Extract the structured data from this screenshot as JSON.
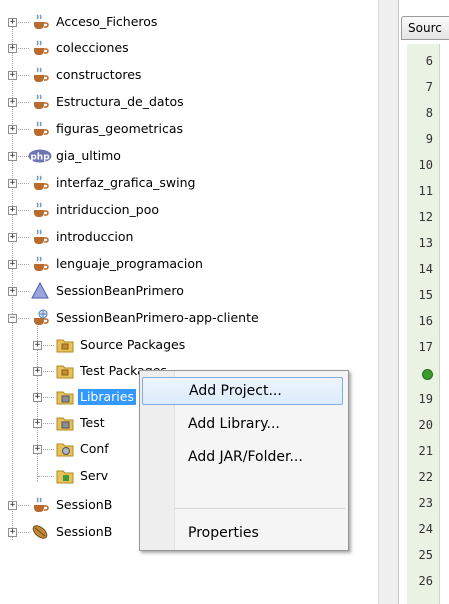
{
  "project_tree": {
    "projects": [
      {
        "label": "Acceso_Ficheros",
        "icon": "java-cup-icon"
      },
      {
        "label": "colecciones",
        "icon": "java-cup-icon"
      },
      {
        "label": "constructores",
        "icon": "java-cup-icon"
      },
      {
        "label": "Estructura_de_datos",
        "icon": "java-cup-icon"
      },
      {
        "label": "figuras_geometricas",
        "icon": "java-cup-icon"
      },
      {
        "label": "gia_ultimo",
        "icon": "php-icon"
      },
      {
        "label": "interfaz_grafica_swing",
        "icon": "java-cup-icon"
      },
      {
        "label": "intriduccion_poo",
        "icon": "java-cup-icon"
      },
      {
        "label": "introduccion",
        "icon": "java-cup-icon"
      },
      {
        "label": "lenguaje_programacion",
        "icon": "java-cup-icon"
      },
      {
        "label": "SessionBeanPrimero",
        "icon": "ejb-triangle-icon"
      },
      {
        "label": "SessionBeanPrimero-app-cliente",
        "icon": "java-app-client-icon"
      }
    ],
    "children": [
      {
        "label": "Source Packages",
        "icon": "package-folder-icon"
      },
      {
        "label": "Test Packages",
        "icon": "package-folder-icon"
      },
      {
        "label": "Libraries",
        "icon": "library-folder-icon",
        "selected": true
      },
      {
        "label": "Test",
        "icon": "library-folder-icon"
      },
      {
        "label": "Conf",
        "icon": "config-folder-icon"
      },
      {
        "label": "Serv",
        "icon": "server-folder-icon"
      }
    ],
    "trailing_projects": [
      {
        "label": "SessionB",
        "icon": "java-cup-icon"
      },
      {
        "label": "SessionB",
        "icon": "bean-icon"
      }
    ]
  },
  "editor": {
    "tab_label": "Sourc",
    "line_numbers": [
      "6",
      "7",
      "8",
      "9",
      "10",
      "11",
      "12",
      "13",
      "14",
      "15",
      "16",
      "17",
      "",
      "19",
      "20",
      "21",
      "22",
      "23",
      "24",
      "25",
      "26"
    ],
    "marker_line_index": 12
  },
  "context_menu": {
    "items": [
      {
        "label": "Add Project...",
        "hovered": true
      },
      {
        "label": "Add Library..."
      },
      {
        "label": "Add JAR/Folder..."
      },
      {
        "label": "Properties"
      }
    ]
  },
  "colors": {
    "selection": "#3399ff",
    "menu_hover_border": "#84acdd",
    "gutter": "#eaf2e3"
  }
}
